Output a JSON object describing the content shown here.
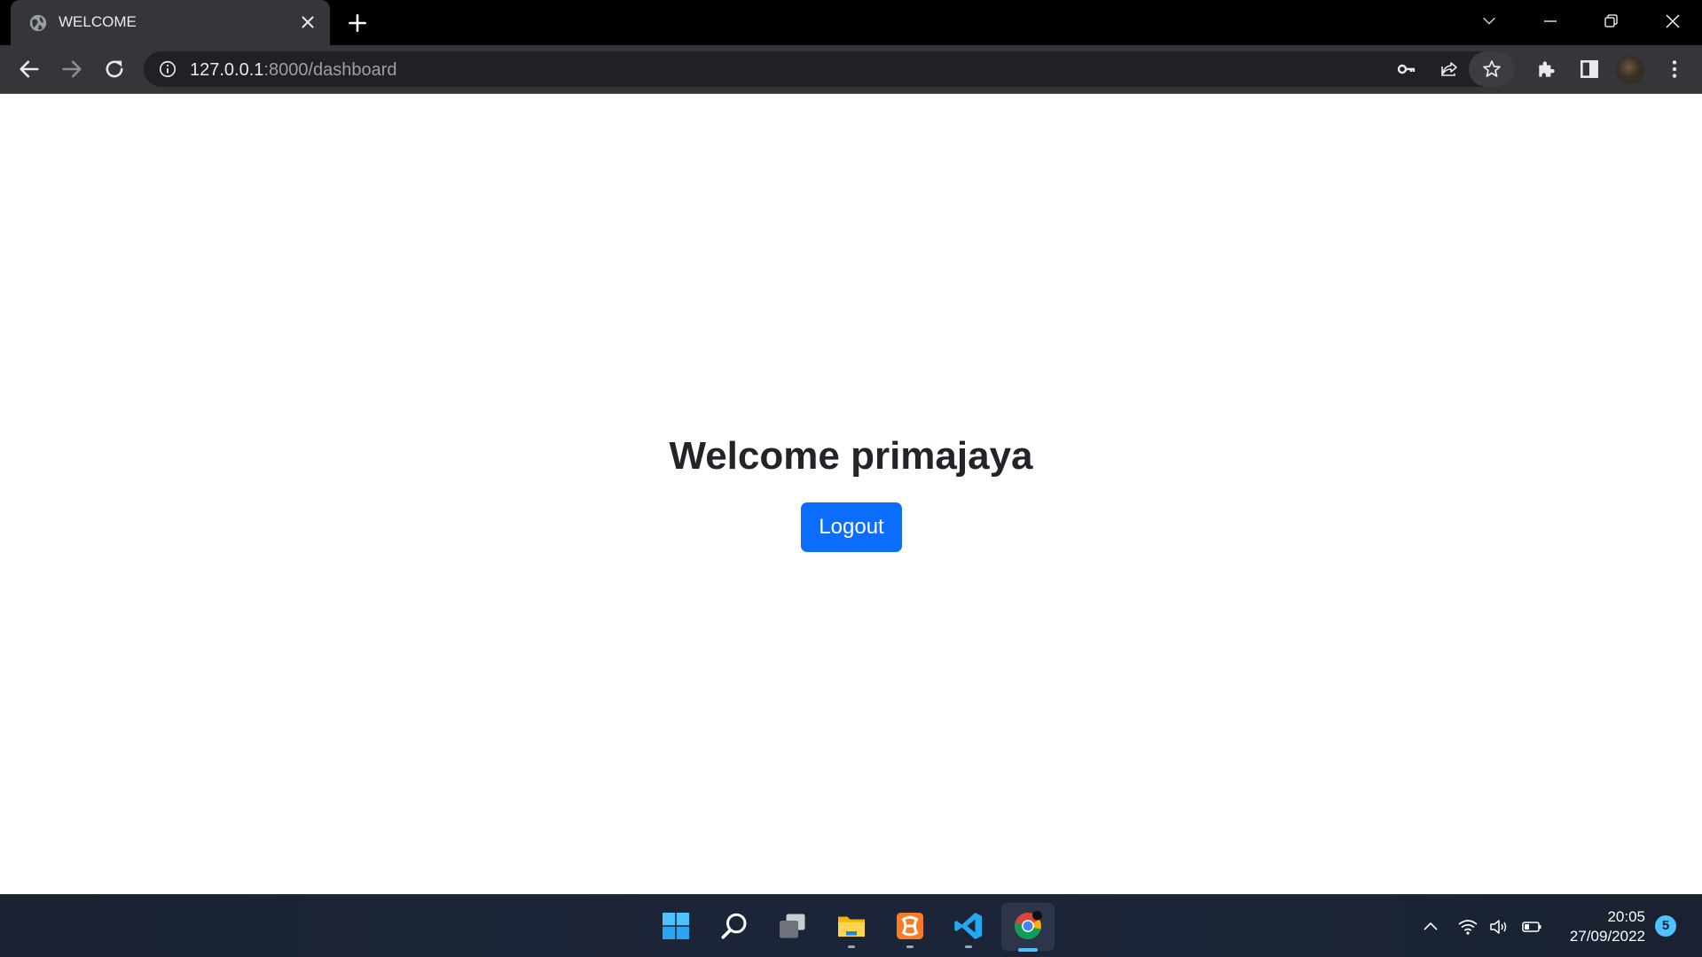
{
  "browser": {
    "tab_title": "WELCOME",
    "url_host": "127.0.0.1",
    "url_rest": ":8000/dashboard"
  },
  "page": {
    "heading": "Welcome primajaya",
    "logout_label": "Logout"
  },
  "taskbar": {
    "time": "20:05",
    "date": "27/09/2022",
    "notification_count": "5",
    "apps": [
      "start",
      "search",
      "task-view",
      "file-explorer",
      "xampp",
      "vscode",
      "chrome"
    ]
  },
  "colors": {
    "primary_button": "#0d6efd",
    "heading_text": "#212529",
    "browser_chrome": "#35363a",
    "taskbar": "#1c2538",
    "accent": "#4cc2ff"
  }
}
